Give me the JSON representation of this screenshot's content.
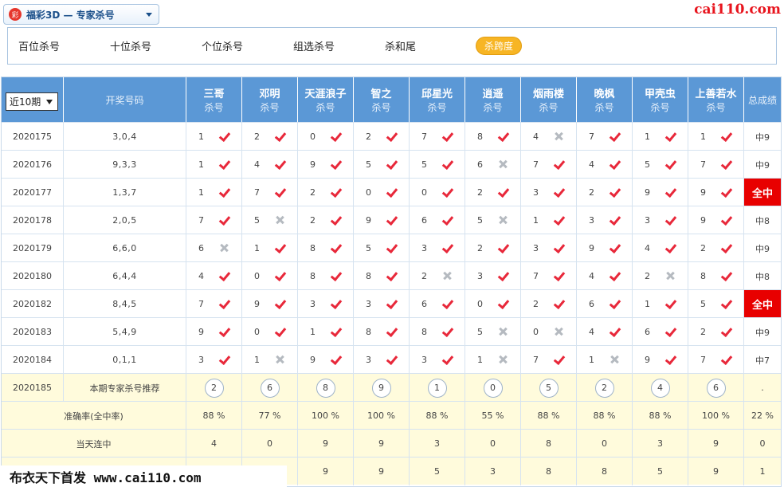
{
  "selector": {
    "icon": "彩",
    "label": "福彩3D — 专家杀号"
  },
  "site_logo": "cai110.com",
  "tabs": [
    "百位杀号",
    "十位杀号",
    "个位杀号",
    "组选杀号",
    "杀和尾",
    "杀跨度"
  ],
  "active_tab": 5,
  "period_select": "近10期",
  "headers": {
    "draw": "开奖号码",
    "total": "总成绩",
    "kill": "杀号"
  },
  "experts": [
    "三哥",
    "邓明",
    "天涯浪子",
    "智之",
    "邱星光",
    "逍遥",
    "烟雨楼",
    "晚枫",
    "甲壳虫",
    "上善若水"
  ],
  "rows": [
    {
      "issue": "2020175",
      "draw": "3,0,4",
      "picks": [
        1,
        2,
        0,
        2,
        7,
        8,
        4,
        7,
        1,
        1
      ],
      "hits": [
        1,
        1,
        1,
        1,
        1,
        1,
        0,
        1,
        1,
        1
      ],
      "total": "中9"
    },
    {
      "issue": "2020176",
      "draw": "9,3,3",
      "picks": [
        1,
        4,
        9,
        5,
        5,
        6,
        7,
        4,
        5,
        7
      ],
      "hits": [
        1,
        1,
        1,
        1,
        1,
        0,
        1,
        1,
        1,
        1
      ],
      "total": "中9"
    },
    {
      "issue": "2020177",
      "draw": "1,3,7",
      "picks": [
        1,
        7,
        2,
        0,
        0,
        2,
        3,
        2,
        9,
        9
      ],
      "hits": [
        1,
        1,
        1,
        1,
        1,
        1,
        1,
        1,
        1,
        1
      ],
      "total": "全中"
    },
    {
      "issue": "2020178",
      "draw": "2,0,5",
      "picks": [
        7,
        5,
        2,
        9,
        6,
        5,
        1,
        3,
        3,
        9
      ],
      "hits": [
        1,
        0,
        1,
        1,
        1,
        0,
        1,
        1,
        1,
        1
      ],
      "total": "中8"
    },
    {
      "issue": "2020179",
      "draw": "6,6,0",
      "picks": [
        6,
        1,
        8,
        5,
        3,
        2,
        3,
        9,
        4,
        2
      ],
      "hits": [
        0,
        1,
        1,
        1,
        1,
        1,
        1,
        1,
        1,
        1
      ],
      "total": "中9"
    },
    {
      "issue": "2020180",
      "draw": "6,4,4",
      "picks": [
        4,
        0,
        8,
        8,
        2,
        3,
        7,
        4,
        2,
        8
      ],
      "hits": [
        1,
        1,
        1,
        1,
        0,
        1,
        1,
        1,
        0,
        1
      ],
      "total": "中8"
    },
    {
      "issue": "2020182",
      "draw": "8,4,5",
      "picks": [
        7,
        9,
        3,
        3,
        6,
        0,
        2,
        6,
        1,
        5
      ],
      "hits": [
        1,
        1,
        1,
        1,
        1,
        1,
        1,
        1,
        1,
        1
      ],
      "total": "全中"
    },
    {
      "issue": "2020183",
      "draw": "5,4,9",
      "picks": [
        9,
        0,
        1,
        8,
        8,
        5,
        0,
        4,
        6,
        2
      ],
      "hits": [
        1,
        1,
        1,
        1,
        1,
        0,
        0,
        1,
        1,
        1
      ],
      "total": "中9"
    },
    {
      "issue": "2020184",
      "draw": "0,1,1",
      "picks": [
        3,
        1,
        9,
        3,
        3,
        1,
        7,
        1,
        9,
        7
      ],
      "hits": [
        1,
        0,
        1,
        1,
        1,
        0,
        1,
        0,
        1,
        1
      ],
      "total": "中7"
    }
  ],
  "recommend": {
    "issue": "2020185",
    "label": "本期专家杀号推荐",
    "picks": [
      2,
      6,
      8,
      9,
      1,
      0,
      5,
      2,
      4,
      6
    ],
    "total": "."
  },
  "accuracy": {
    "label": "准确率(全中率)",
    "values": [
      "88 %",
      "77 %",
      "100 %",
      "100 %",
      "88 %",
      "55 %",
      "88 %",
      "88 %",
      "88 %",
      "100 %"
    ],
    "total": "22 %"
  },
  "streak": {
    "label": "当天连中",
    "values": [
      4,
      0,
      9,
      9,
      3,
      0,
      8,
      0,
      3,
      9
    ],
    "total": 0
  },
  "max_streak": {
    "values": [
      "",
      "",
      9,
      9,
      5,
      3,
      8,
      8,
      5,
      9
    ],
    "total": 1
  },
  "watermark": "布衣天下首发 www.cai110.com",
  "colors": {
    "header_bg": "#5b98d6",
    "hit": "#e8283a",
    "miss": "#b5bac0",
    "full_hit": "#e80000",
    "active_tab": "#f7b524"
  }
}
